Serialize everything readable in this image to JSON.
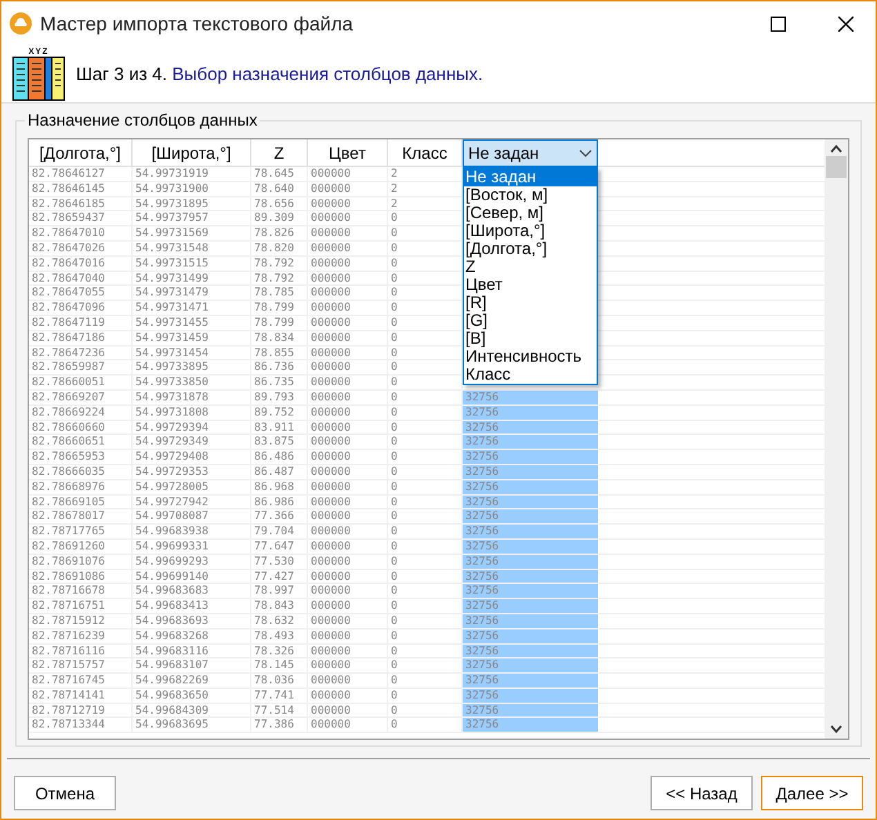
{
  "window": {
    "title": "Мастер импорта текстового файла"
  },
  "header": {
    "icon_caption": "XYZ",
    "step": "Шаг 3 из 4.",
    "description": "Выбор назначения столбцов данных."
  },
  "group": {
    "title": "Назначение столбцов данных"
  },
  "table": {
    "columns": [
      "[Долгота,°]",
      "[Широта,°]",
      "Z",
      "Цвет",
      "Класс"
    ],
    "select": {
      "value": "Не задан",
      "expanded": true,
      "options": [
        {
          "label": "Не задан",
          "selected": true
        },
        {
          "label": "[Восток, м]",
          "selected": false
        },
        {
          "label": "[Север, м]",
          "selected": false
        },
        {
          "label": "[Широта,°]",
          "selected": false
        },
        {
          "label": "[Долгота,°]",
          "selected": false
        },
        {
          "label": "Z",
          "selected": false
        },
        {
          "label": "Цвет",
          "selected": false
        },
        {
          "label": "[R]",
          "selected": false
        },
        {
          "label": "[G]",
          "selected": false
        },
        {
          "label": "[B]",
          "selected": false
        },
        {
          "label": "Интенсивность",
          "selected": false
        },
        {
          "label": "Класс",
          "selected": false
        }
      ]
    },
    "rows": [
      {
        "cells": [
          "82.78646127",
          "54.99731919",
          "78.645",
          "000000",
          "2"
        ]
      },
      {
        "cells": [
          "82.78646145",
          "54.99731900",
          "78.640",
          "000000",
          "2"
        ]
      },
      {
        "cells": [
          "82.78646185",
          "54.99731895",
          "78.656",
          "000000",
          "2"
        ]
      },
      {
        "cells": [
          "82.78659437",
          "54.99737957",
          "89.309",
          "000000",
          "0"
        ]
      },
      {
        "cells": [
          "82.78647010",
          "54.99731569",
          "78.826",
          "000000",
          "0"
        ]
      },
      {
        "cells": [
          "82.78647026",
          "54.99731548",
          "78.820",
          "000000",
          "0"
        ]
      },
      {
        "cells": [
          "82.78647016",
          "54.99731515",
          "78.792",
          "000000",
          "0"
        ]
      },
      {
        "cells": [
          "82.78647040",
          "54.99731499",
          "78.792",
          "000000",
          "0"
        ]
      },
      {
        "cells": [
          "82.78647055",
          "54.99731479",
          "78.785",
          "000000",
          "0"
        ]
      },
      {
        "cells": [
          "82.78647096",
          "54.99731471",
          "78.799",
          "000000",
          "0"
        ]
      },
      {
        "cells": [
          "82.78647119",
          "54.99731455",
          "78.799",
          "000000",
          "0"
        ]
      },
      {
        "cells": [
          "82.78647186",
          "54.99731459",
          "78.834",
          "000000",
          "0"
        ]
      },
      {
        "cells": [
          "82.78647236",
          "54.99731454",
          "78.855",
          "000000",
          "0"
        ]
      },
      {
        "cells": [
          "82.78659987",
          "54.99733895",
          "86.736",
          "000000",
          "0"
        ]
      },
      {
        "cells": [
          "82.78660051",
          "54.99733850",
          "86.735",
          "000000",
          "0"
        ]
      },
      {
        "cells": [
          "82.78669207",
          "54.99731878",
          "89.793",
          "000000",
          "0"
        ],
        "column_6": "32756"
      },
      {
        "cells": [
          "82.78669224",
          "54.99731808",
          "89.752",
          "000000",
          "0"
        ],
        "column_6": "32756"
      },
      {
        "cells": [
          "82.78660660",
          "54.99729394",
          "83.911",
          "000000",
          "0"
        ],
        "column_6": "32756"
      },
      {
        "cells": [
          "82.78660651",
          "54.99729349",
          "83.875",
          "000000",
          "0"
        ],
        "column_6": "32756"
      },
      {
        "cells": [
          "82.78665953",
          "54.99729408",
          "86.486",
          "000000",
          "0"
        ],
        "column_6": "32756"
      },
      {
        "cells": [
          "82.78666035",
          "54.99729353",
          "86.487",
          "000000",
          "0"
        ],
        "column_6": "32756"
      },
      {
        "cells": [
          "82.78668976",
          "54.99728005",
          "86.968",
          "000000",
          "0"
        ],
        "column_6": "32756"
      },
      {
        "cells": [
          "82.78669105",
          "54.99727942",
          "86.986",
          "000000",
          "0"
        ],
        "column_6": "32756"
      },
      {
        "cells": [
          "82.78678017",
          "54.99708087",
          "77.366",
          "000000",
          "0"
        ],
        "column_6": "32756"
      },
      {
        "cells": [
          "82.78717765",
          "54.99683938",
          "79.704",
          "000000",
          "0"
        ],
        "column_6": "32756"
      },
      {
        "cells": [
          "82.78691260",
          "54.99699331",
          "77.647",
          "000000",
          "0"
        ],
        "column_6": "32756"
      },
      {
        "cells": [
          "82.78691076",
          "54.99699293",
          "77.530",
          "000000",
          "0"
        ],
        "column_6": "32756"
      },
      {
        "cells": [
          "82.78691086",
          "54.99699140",
          "77.427",
          "000000",
          "0"
        ],
        "column_6": "32756"
      },
      {
        "cells": [
          "82.78716678",
          "54.99683683",
          "78.997",
          "000000",
          "0"
        ],
        "column_6": "32756"
      },
      {
        "cells": [
          "82.78716751",
          "54.99683413",
          "78.843",
          "000000",
          "0"
        ],
        "column_6": "32756"
      },
      {
        "cells": [
          "82.78715912",
          "54.99683693",
          "78.632",
          "000000",
          "0"
        ],
        "column_6": "32756"
      },
      {
        "cells": [
          "82.78716239",
          "54.99683268",
          "78.493",
          "000000",
          "0"
        ],
        "column_6": "32756"
      },
      {
        "cells": [
          "82.78716116",
          "54.99683116",
          "78.326",
          "000000",
          "0"
        ],
        "column_6": "32756"
      },
      {
        "cells": [
          "82.78715757",
          "54.99683107",
          "78.145",
          "000000",
          "0"
        ],
        "column_6": "32756"
      },
      {
        "cells": [
          "82.78716745",
          "54.99682269",
          "78.036",
          "000000",
          "0"
        ],
        "column_6": "32756"
      },
      {
        "cells": [
          "82.78714141",
          "54.99683650",
          "77.741",
          "000000",
          "0"
        ],
        "column_6": "32756"
      },
      {
        "cells": [
          "82.78712719",
          "54.99684309",
          "77.514",
          "000000",
          "0"
        ],
        "column_6": "32756"
      },
      {
        "cells": [
          "82.78713344",
          "54.99683695",
          "77.386",
          "000000",
          "0"
        ],
        "column_6": "32756"
      }
    ]
  },
  "buttons": [
    {
      "label": "Отмена",
      "default": false
    },
    {
      "label": "<< Назад",
      "default": false
    },
    {
      "label": "Далее >>",
      "default": true
    }
  ]
}
